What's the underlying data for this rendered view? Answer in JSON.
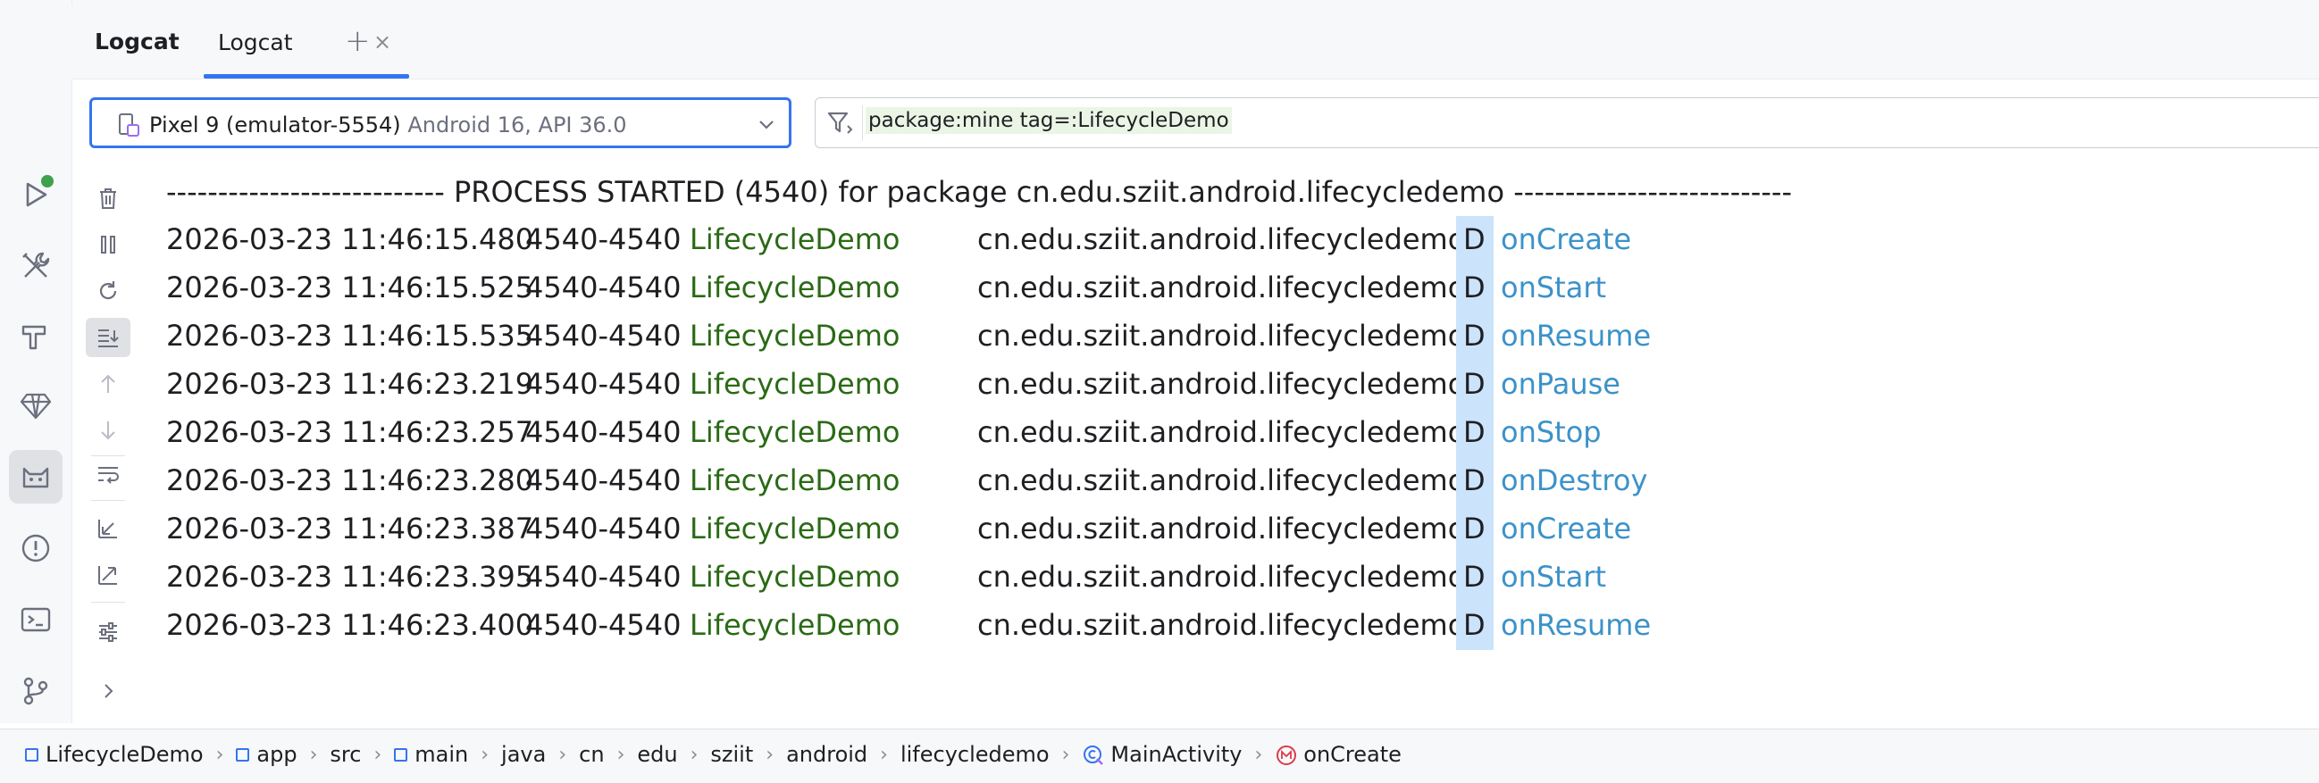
{
  "toolwindow": {
    "title": "Logcat",
    "tabs": [
      {
        "label": "Logcat",
        "close": "×"
      }
    ],
    "add_tab": "+"
  },
  "device_selector": {
    "device": "Pixel 9 (emulator-5554)",
    "api": "Android 16, API 36.0"
  },
  "filter": {
    "query": "package:mine tag=:LifecycleDemo"
  },
  "log": {
    "header": "--------------------------- PROCESS STARTED (4540) for package cn.edu.sziit.android.lifecycledemo ---------------------------",
    "rows": [
      {
        "time": "2026-03-23 11:46:15.480",
        "pid": "4540-4540",
        "tag": "LifecycleDemo",
        "package": "cn.edu.sziit.android.lifecycledemo",
        "level": "D",
        "message": "onCreate"
      },
      {
        "time": "2026-03-23 11:46:15.525",
        "pid": "4540-4540",
        "tag": "LifecycleDemo",
        "package": "cn.edu.sziit.android.lifecycledemo",
        "level": "D",
        "message": "onStart"
      },
      {
        "time": "2026-03-23 11:46:15.535",
        "pid": "4540-4540",
        "tag": "LifecycleDemo",
        "package": "cn.edu.sziit.android.lifecycledemo",
        "level": "D",
        "message": "onResume"
      },
      {
        "time": "2026-03-23 11:46:23.219",
        "pid": "4540-4540",
        "tag": "LifecycleDemo",
        "package": "cn.edu.sziit.android.lifecycledemo",
        "level": "D",
        "message": "onPause"
      },
      {
        "time": "2026-03-23 11:46:23.257",
        "pid": "4540-4540",
        "tag": "LifecycleDemo",
        "package": "cn.edu.sziit.android.lifecycledemo",
        "level": "D",
        "message": "onStop"
      },
      {
        "time": "2026-03-23 11:46:23.280",
        "pid": "4540-4540",
        "tag": "LifecycleDemo",
        "package": "cn.edu.sziit.android.lifecycledemo",
        "level": "D",
        "message": "onDestroy"
      },
      {
        "time": "2026-03-23 11:46:23.387",
        "pid": "4540-4540",
        "tag": "LifecycleDemo",
        "package": "cn.edu.sziit.android.lifecycledemo",
        "level": "D",
        "message": "onCreate"
      },
      {
        "time": "2026-03-23 11:46:23.395",
        "pid": "4540-4540",
        "tag": "LifecycleDemo",
        "package": "cn.edu.sziit.android.lifecycledemo",
        "level": "D",
        "message": "onStart"
      },
      {
        "time": "2026-03-23 11:46:23.400",
        "pid": "4540-4540",
        "tag": "LifecycleDemo",
        "package": "cn.edu.sziit.android.lifecycledemo",
        "level": "D",
        "message": "onResume"
      }
    ]
  },
  "breadcrumb": {
    "items": [
      "LifecycleDemo",
      "app",
      "src",
      "main",
      "java",
      "cn",
      "edu",
      "sziit",
      "android",
      "lifecycledemo",
      "MainActivity",
      "onCreate"
    ],
    "separator": "›"
  },
  "colors": {
    "accent": "#3574f0",
    "tag": "#2a6a15",
    "message": "#3c92c9",
    "level_bg": "#cce3fc",
    "run_status": "#3fa14a"
  },
  "icons": {
    "left_toolbar": [
      "run-icon",
      "build-tools-icon",
      "hammer-icon",
      "gem-icon",
      "logcat-icon",
      "problems-icon",
      "terminal-icon",
      "git-icon"
    ],
    "logcat_toolbar": [
      "trash-icon",
      "pause-icon",
      "restart-icon",
      "scroll-to-end-icon",
      "up-arrow-icon",
      "down-arrow-icon",
      "soft-wrap-icon",
      "collapse-icon",
      "expand-icon",
      "settings-sliders-icon",
      "more-chevron-icon"
    ]
  }
}
